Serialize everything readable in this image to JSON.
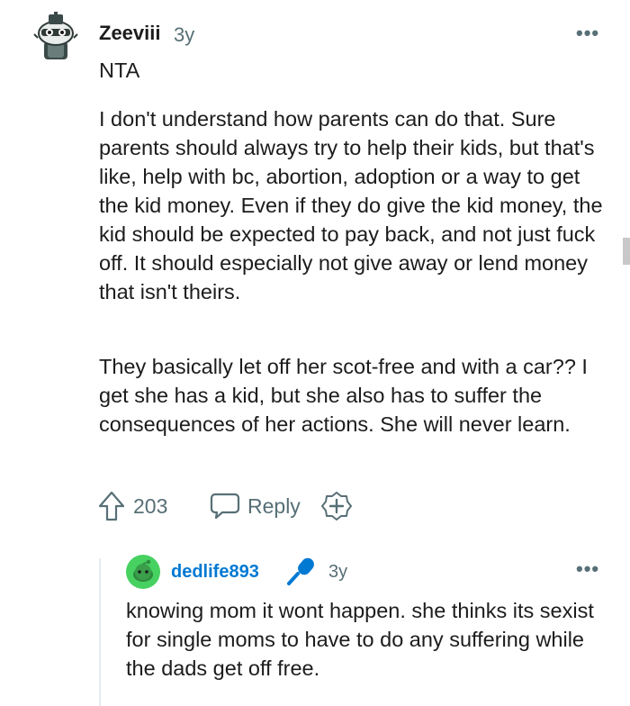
{
  "comment": {
    "author": "Zeeviii",
    "age": "3y",
    "more_label": "•••",
    "paragraphs": [
      "NTA",
      "I don't understand how parents can do that. Sure parents should always try to help their kids, but that's like, help with bc, abortion, adoption or a way to get the kid money. Even if they do give the kid money, the kid should be expected to pay back, and not just fuck off. It should especially not give away or lend money that isn't theirs.",
      "They basically let off her scot-free and with a car?? I get she has a kid, but she also has to suffer the consequences of her actions. She will never learn."
    ],
    "score": "203",
    "reply_label": "Reply"
  },
  "reply": {
    "author": "dedlife893",
    "age": "3y",
    "more_label": "•••",
    "body": "knowing mom it wont happen. she thinks its sexist for single moms to have to do any suffering while the dads get off free."
  },
  "icons": {
    "upvote": "upvote-arrow-icon",
    "reply": "speech-bubble-icon",
    "award": "plus-circle-icon",
    "mic": "microphone-icon",
    "more": "ellipsis-icon"
  },
  "colors": {
    "text": "#1c1c1c",
    "meta": "#576f76",
    "reply_author": "#0079d3",
    "mic": "#0079d3",
    "avatar_green": "#46d160"
  }
}
